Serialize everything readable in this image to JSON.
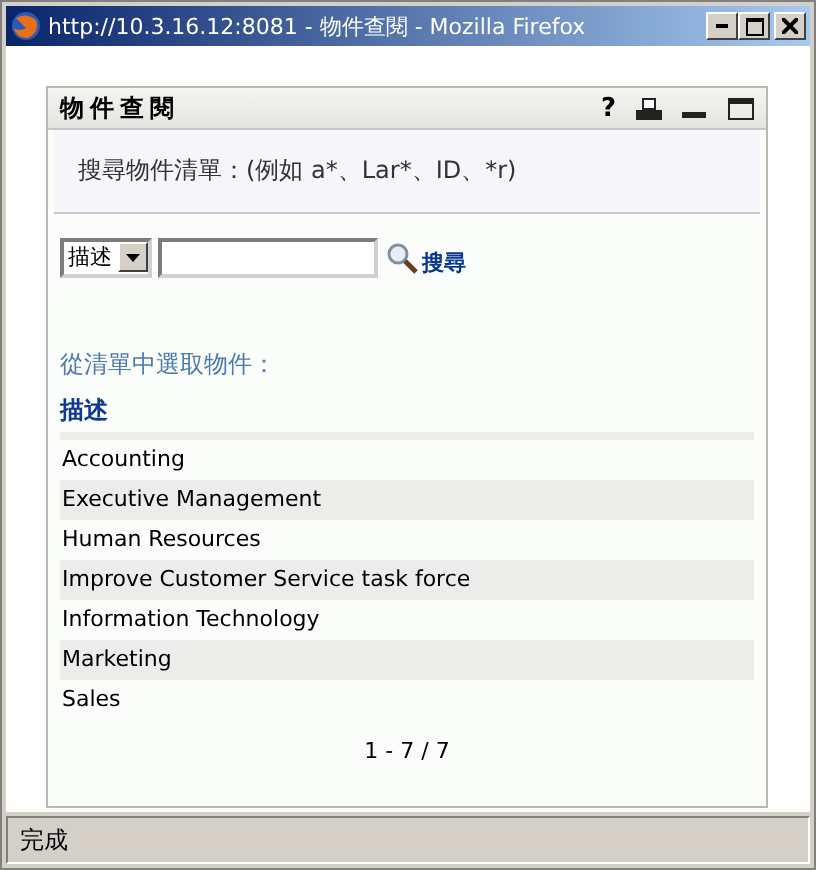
{
  "window": {
    "title": "http://10.3.16.12:8081 - 物件查閱 - Mozilla Firefox"
  },
  "panel": {
    "title": "物件查閱",
    "help": "?"
  },
  "search": {
    "hint": "搜尋物件清單：(例如 a*、Lar*、ID、*r)",
    "field_select": "描述",
    "button": "搜尋"
  },
  "list": {
    "prompt": "從清單中選取物件：",
    "column": "描述",
    "rows": [
      "Accounting",
      "Executive Management",
      "Human Resources",
      "Improve Customer Service task force",
      "Information Technology",
      "Marketing",
      "Sales"
    ],
    "pagination": "1 - 7 / 7"
  },
  "status_bar": "完成"
}
